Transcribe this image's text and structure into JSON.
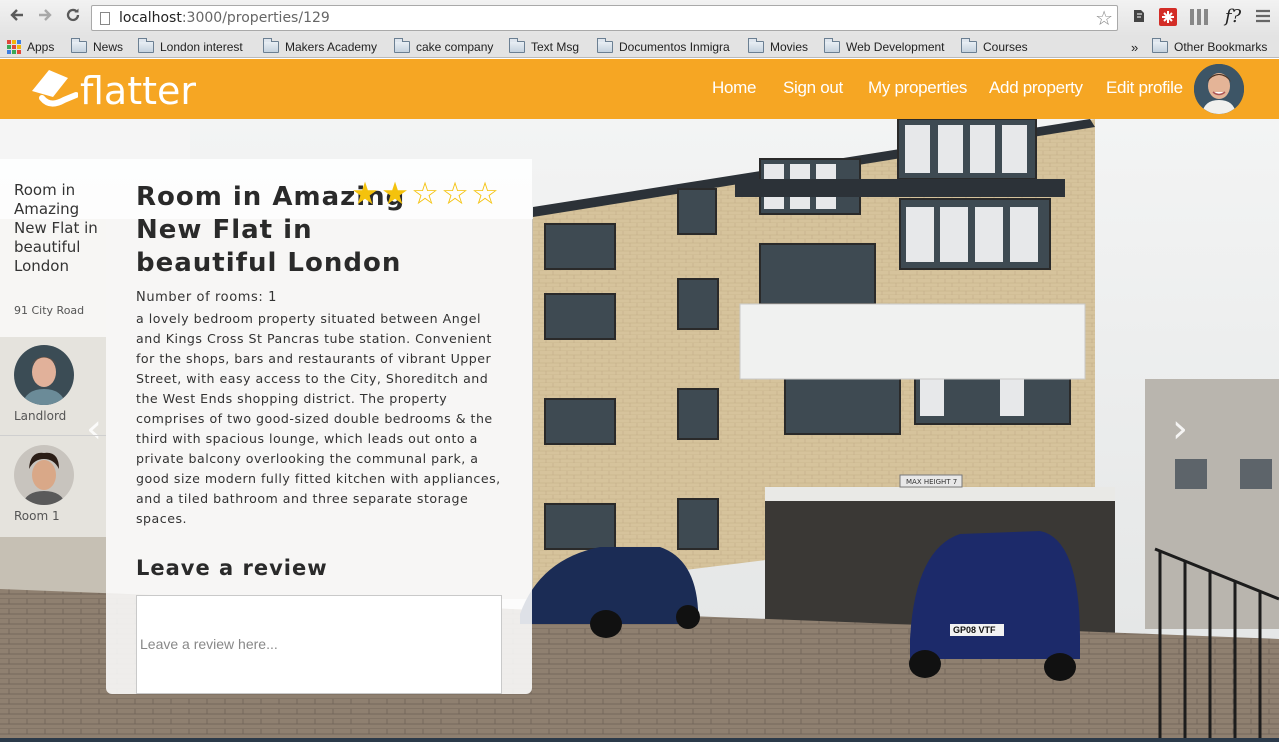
{
  "browser": {
    "url_host": "localhost",
    "url_path": ":3000/properties/129",
    "bookmarks": [
      {
        "label": "Apps",
        "type": "apps"
      },
      {
        "label": "News",
        "type": "folder"
      },
      {
        "label": "London interest",
        "type": "folder"
      },
      {
        "label": "Makers Academy",
        "type": "folder"
      },
      {
        "label": "cake company",
        "type": "folder"
      },
      {
        "label": "Text Msg",
        "type": "folder"
      },
      {
        "label": "Documentos Inmigra",
        "type": "folder"
      },
      {
        "label": "Movies",
        "type": "folder"
      },
      {
        "label": "Web Development",
        "type": "folder"
      },
      {
        "label": "Courses",
        "type": "folder"
      }
    ],
    "overflow_label": "»",
    "other_bookmarks": "Other Bookmarks",
    "extension_f": "f?"
  },
  "site": {
    "logo_text": "flatter",
    "brand_color": "#f6a623",
    "nav": [
      "Home",
      "Sign out",
      "My properties",
      "Add property",
      "Edit profile"
    ]
  },
  "sidebar": {
    "title": "Room in Amazing New Flat in beautiful London",
    "address": "91 City Road",
    "people": [
      {
        "label": "Landlord"
      },
      {
        "label": "Room 1"
      }
    ]
  },
  "property": {
    "title": "Room in Amazing New Flat in beautiful London",
    "rating": 2,
    "rating_max": 5,
    "rooms": "Number of rooms: 1",
    "description": "a lovely bedroom property situated between Angel and Kings Cross St Pancras tube station. Convenient for the shops, bars and restaurants of vibrant Upper Street, with easy access to the City, Shoreditch and the West Ends shopping district. The property comprises of two good-sized double bedrooms & the third with spacious lounge, which leads out onto a private balcony overlooking the communal park, a good size modern fully fitted kitchen with appliances, and a tiled bathroom and three separate storage spaces."
  },
  "review": {
    "heading": "Leave a review",
    "placeholder": "Leave a review here..."
  },
  "carousel": {
    "prev": "‹",
    "next": "›"
  },
  "photo": {
    "plate_1": "MAX HEIGHT 7",
    "plate_2": "GP08 VTF"
  }
}
